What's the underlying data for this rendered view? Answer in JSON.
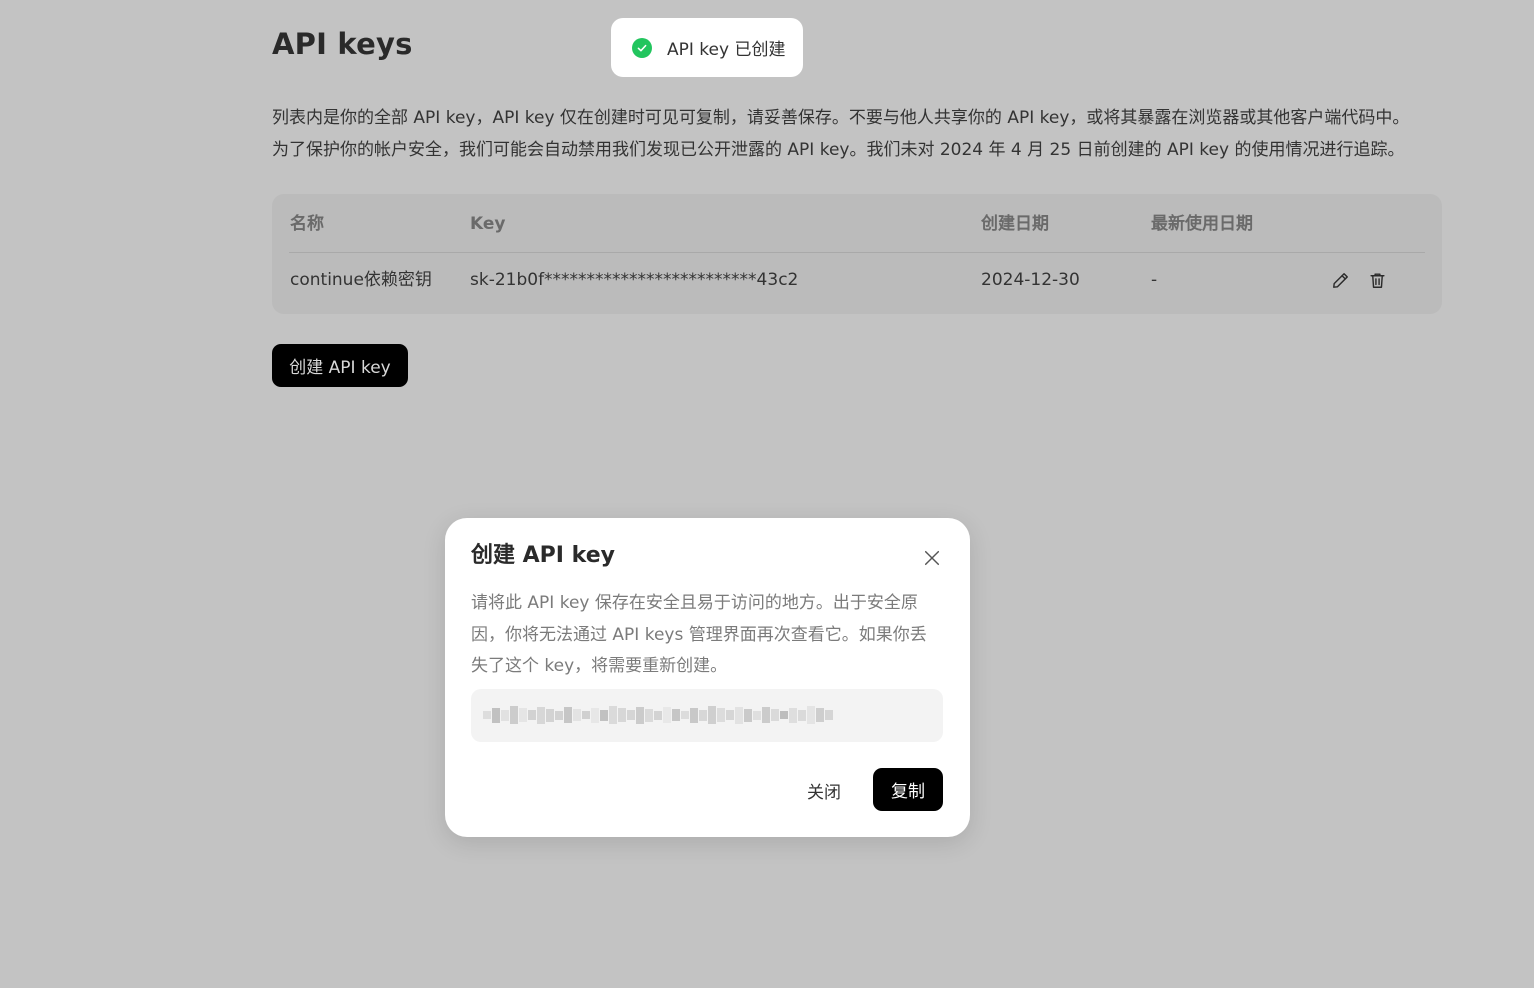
{
  "page": {
    "title": "API keys",
    "description_lines": [
      "列表内是你的全部 API key，API key 仅在创建时可见可复制，请妥善保存。不要与他人共享你的 API key，或将其暴露在浏览器或其他客户端代码中。",
      "为了保护你的帐户安全，我们可能会自动禁用我们发现已公开泄露的 API key。我们未对 2024 年 4 月 25 日前创建的 API key 的使用情况进行追踪。"
    ]
  },
  "toast": {
    "text": "API key 已创建",
    "status_color": "#22c55e",
    "icon": "check-circle-icon"
  },
  "table": {
    "headers": {
      "name": "名称",
      "key": "Key",
      "created": "创建日期",
      "last_used": "最新使用日期"
    },
    "rows": [
      {
        "name": "continue依赖密钥",
        "key": "sk-21b0f*************************43c2",
        "created": "2024-12-30",
        "last_used": "-"
      }
    ],
    "row_action_icons": [
      "pencil-icon",
      "trash-icon"
    ]
  },
  "create_button": {
    "label": "创建 API key"
  },
  "modal": {
    "title": "创建 API key",
    "description_lines": [
      "请将此 API key 保存在安全且易于访问的地方。出于安全原",
      "因，你将无法通过 API keys 管理界面再次查看它。如果你丢",
      "失了这个 key，将需要重新创建。"
    ],
    "cancel_label": "关闭",
    "copy_label": "复制",
    "close_icon": "close-icon"
  }
}
